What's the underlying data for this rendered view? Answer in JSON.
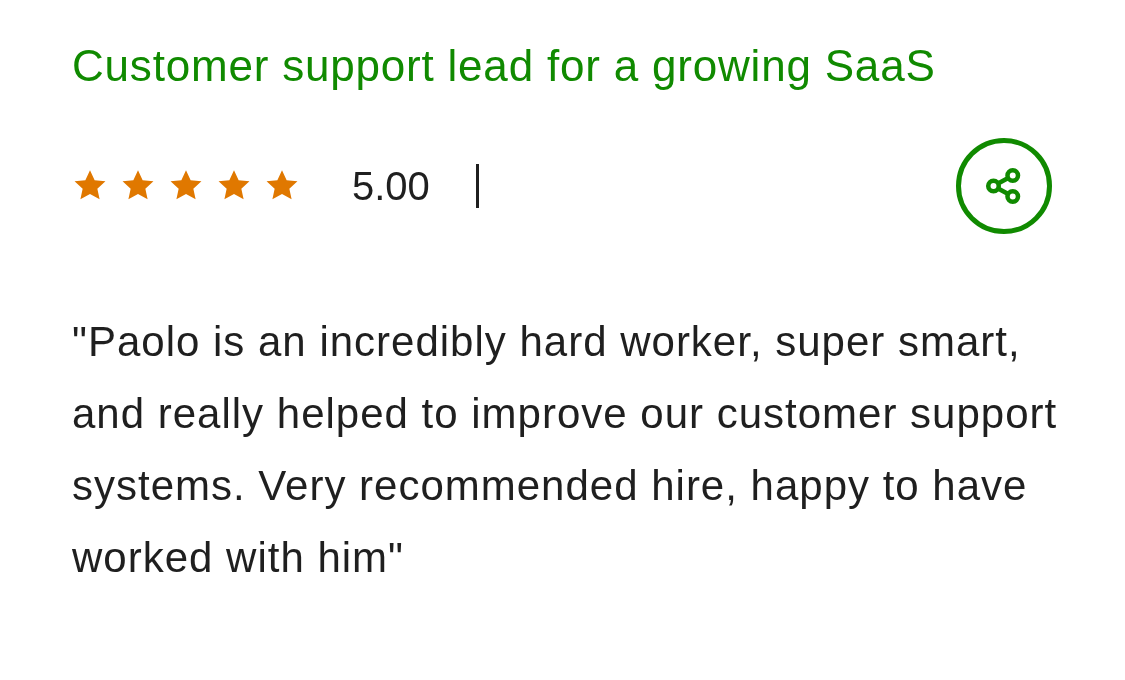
{
  "review": {
    "title": "Customer support lead for a growing SaaS",
    "stars": 5,
    "rating": "5.00",
    "comment": "\"Paolo is an incredibly hard worker, super smart, and really helped to improve our customer support systems. Very recommended hire, happy to have worked with him\""
  }
}
